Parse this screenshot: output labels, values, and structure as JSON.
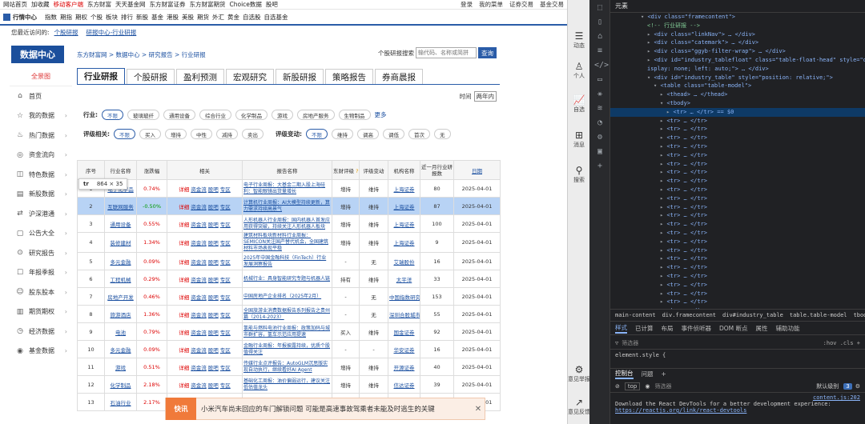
{
  "topbar": {
    "left": [
      "网站首页",
      "加收藏",
      "移动客户端",
      "东方财富",
      "天天基金网",
      "东方财富证券",
      "东方财富期货",
      "Choice数据",
      "股吧"
    ],
    "right": [
      "登录",
      "我的菜单",
      "证券交易",
      "基金交易"
    ]
  },
  "navbar": {
    "home": "行情中心",
    "items": [
      "指数",
      "期指",
      "期权",
      "个股",
      "板块",
      "排行",
      "新股",
      "基金",
      "港股",
      "美股",
      "期货",
      "外汇",
      "黄金",
      "自选股",
      "自选基金"
    ]
  },
  "recent": {
    "label": "您最近访问的:",
    "links": [
      "个股研报",
      "研报中心-行业研报"
    ]
  },
  "header": {
    "logo": "数据中心",
    "crumbs": "东方财富网 > 数据中心 > 研究报告 > 行业研报",
    "search_label": "个股研报搜索",
    "search_placeholder": "输代码、名称或简拼",
    "search_button": "查询"
  },
  "sidebar": {
    "head": "全景图",
    "items": [
      {
        "label": "首页",
        "icon": "home-icon"
      },
      {
        "label": "我的数据",
        "icon": "star-icon"
      },
      {
        "label": "热门数据",
        "icon": "fire-icon"
      },
      {
        "label": "资金流向",
        "icon": "money-icon"
      },
      {
        "label": "特色数据",
        "icon": "feature-icon"
      },
      {
        "label": "新股数据",
        "icon": "new-stock-icon"
      },
      {
        "label": "沪深港通",
        "icon": "connect-icon"
      },
      {
        "label": "公告大全",
        "icon": "notice-icon"
      },
      {
        "label": "研究报告",
        "icon": "report-icon"
      },
      {
        "label": "年报季报",
        "icon": "annual-icon"
      },
      {
        "label": "股东股本",
        "icon": "shareholder-icon"
      },
      {
        "label": "期货期权",
        "icon": "futures-icon"
      },
      {
        "label": "经济数据",
        "icon": "economy-icon"
      },
      {
        "label": "基金数据",
        "icon": "fund-icon"
      }
    ]
  },
  "tabs": [
    "行业研报",
    "个股研报",
    "盈利预测",
    "宏观研究",
    "新股研报",
    "策略报告",
    "券商晨报"
  ],
  "time": {
    "label": "时间",
    "value": "两年内"
  },
  "filters": {
    "industry_label": "行业:",
    "industry": [
      "不限",
      "玻璃玻纤",
      "通用设备",
      "综合行业",
      "化学制品",
      "游戏",
      "房地产服务",
      "生物制品"
    ],
    "more": "更多",
    "rating_label": "评级相关:",
    "rating": [
      "不限",
      "买入",
      "增持",
      "中性",
      "减持",
      "卖出"
    ],
    "change_label": "评级变动:",
    "change": [
      "不限",
      "维持",
      "调高",
      "调低",
      "首次",
      "无"
    ]
  },
  "table": {
    "headers": [
      "序号",
      "行业名称",
      "涨跌幅",
      "相关",
      "报告名称",
      "东财评级",
      "评级变动",
      "机构名称",
      "近一月行业研报数",
      "日期"
    ],
    "ops": [
      "详细",
      "资金流",
      "股吧",
      "专区"
    ],
    "rows": [
      {
        "n": "1",
        "ind": "电子化学品",
        "pct": "0.74%",
        "up": true,
        "name": "电子行业周报：大基金二期入股上海硅利：智能眼镜出货量增长",
        "rating": "增持",
        "chg": "维持",
        "org": "上海证券",
        "cnt": "80",
        "date": "2025-04-01"
      },
      {
        "n": "2",
        "ind": "互联网服务",
        "pct": "-0.50%",
        "up": false,
        "name": "计算机行业周报：AI大模型持续更新，算力需求持续高景气",
        "rating": "增持",
        "chg": "维持",
        "org": "上海证券",
        "cnt": "87",
        "date": "2025-04-01"
      },
      {
        "n": "3",
        "ind": "通用设备",
        "pct": "0.55%",
        "up": true,
        "name": "人形机器人行业周报：国内机器人首发应用获得突破，持续关注人形机器人板块",
        "rating": "增持",
        "chg": "维持",
        "org": "上海证券",
        "cnt": "100",
        "date": "2025-04-01"
      },
      {
        "n": "4",
        "ind": "装修建材",
        "pct": "1.34%",
        "up": true,
        "name": "建筑材料板块新材料行业周报：SEMICON关注国产替代机会，全国建筑材料市场表现平稳",
        "rating": "增持",
        "chg": "维持",
        "org": "上海证券",
        "cnt": "9",
        "date": "2025-04-01"
      },
      {
        "n": "5",
        "ind": "多元金融",
        "pct": "0.09%",
        "up": true,
        "name": "2025年中国金融科技（FinTech）行业发展洞察报告",
        "rating": "-",
        "chg": "无",
        "org": "艾瑞股份",
        "cnt": "16",
        "date": "2025-04-01"
      },
      {
        "n": "6",
        "ind": "工程机械",
        "pct": "0.29%",
        "up": true,
        "name": "机械行业：具身智能研究专题与机器人链",
        "rating": "持有",
        "chg": "维持",
        "org": "太平洋",
        "cnt": "33",
        "date": "2025-04-01"
      },
      {
        "n": "7",
        "ind": "房地产开发",
        "pct": "0.46%",
        "up": true,
        "name": "中国房地产企业排名（2025年2月）",
        "rating": "-",
        "chg": "无",
        "org": "中国指数研究院",
        "cnt": "153",
        "date": "2025-04-01"
      },
      {
        "n": "8",
        "ind": "旅游酒店",
        "pct": "1.36%",
        "up": true,
        "name": "全国旅游业消费数据报告系列报告之贵州篇（2014-2023）",
        "rating": "-",
        "chg": "无",
        "org": "深圳合股城市",
        "cnt": "55",
        "date": "2025-04-01"
      },
      {
        "n": "9",
        "ind": "电池",
        "pct": "0.79%",
        "up": true,
        "name": "氢能与燃料电池行业周报：政策加码与城市群扩容，氢车示范应用提速",
        "rating": "买入",
        "chg": "维持",
        "org": "国金证券",
        "cnt": "92",
        "date": "2025-04-01"
      },
      {
        "n": "10",
        "ind": "多元金融",
        "pct": "0.09%",
        "up": true,
        "name": "金融行业周报：年报披露持续，优质个股值得关注",
        "rating": "-",
        "chg": "-",
        "org": "华安证券",
        "cnt": "16",
        "date": "2025-04-01"
      },
      {
        "n": "11",
        "ind": "游戏",
        "pct": "0.51%",
        "up": true,
        "name": "传媒行业点评报告：AutoGLM沉思版实现自动执行，继续看好AI Agent",
        "rating": "增持",
        "chg": "维持",
        "org": "开源证券",
        "cnt": "40",
        "date": "2025-04-01"
      },
      {
        "n": "12",
        "ind": "化学制品",
        "pct": "2.18%",
        "up": true,
        "name": "基础化工周报：油价偏弱运行，建议关注低估值龙头",
        "rating": "增持",
        "chg": "维持",
        "org": "信达证券",
        "cnt": "39",
        "date": "2025-04-01"
      },
      {
        "n": "13",
        "ind": "石油行业",
        "pct": "2.17%",
        "up": true,
        "name": "石油石化行业周报",
        "rating": "增持",
        "chg": "维持",
        "org": "上海证券",
        "cnt": "12",
        "date": "2025-04-01"
      }
    ]
  },
  "tooltip": {
    "tag": "tr",
    "size": "864 × 35"
  },
  "kuaixun": {
    "badge": "快讯",
    "text": "小米汽车尚未回应的车门解锁问题 可能是高速事故驾乘者未能及时逃生的关键",
    "close": "✕"
  },
  "edgebar": [
    {
      "glyph": "☰",
      "label": "动态"
    },
    {
      "glyph": "♙",
      "label": "个人"
    },
    {
      "glyph": "📈",
      "label": "自选"
    },
    {
      "glyph": "⊞",
      "label": "消息"
    },
    {
      "glyph": "⚲",
      "label": "搜索"
    },
    {
      "glyph": "⚙",
      "label": "意见举报"
    },
    {
      "glyph": "↗",
      "label": "意见反馈"
    }
  ],
  "devtools": {
    "title": "元素",
    "breadcrumb": [
      "main-content",
      "div.framecontent",
      "div#industry_table",
      "table.table-model",
      "tbody",
      "tr"
    ],
    "style_tabs": [
      "样式",
      "已计算",
      "布局",
      "事件侦听器",
      "DOM 断点",
      "属性",
      "辅助功能"
    ],
    "filter_placeholder": "筛选器",
    "filter_right": ":hov  .cls  +",
    "element_style": "element.style {",
    "console_tabs": [
      "控制台",
      "问题"
    ],
    "console_top": "top",
    "console_filter": "筛选器",
    "console_level": "默认级别",
    "console_count": "3",
    "msg_src": "content.js:202",
    "msg_text": "Download the React DevTools for a better development experience:",
    "msg_link": "https://reactjs.org/link/react-devtools",
    "tree_top": [
      "<div class=\"framecontent\">",
      "<!-- 行业研报 -->",
      "<div class=\"linkNav\"> … </div>",
      "<div class=\"catemark\"> … </div>",
      "<div class=\"ggyb-filter-wrap\"> … </div>",
      "<div id=\"industry_tablefloat\" class=\"table-float-head\" style=\"d",
      "isplay: none; left: auto;\"> … </div>",
      "<div id=\"industry_table\" style=\"position: relative;\">",
      "<table class=\"table-model\">",
      "<thead> … </thead>",
      "<tbody>",
      "<tr> … </tr>  == $0"
    ],
    "tr_line": "<tr> … </tr>",
    "tr_count": 23
  }
}
